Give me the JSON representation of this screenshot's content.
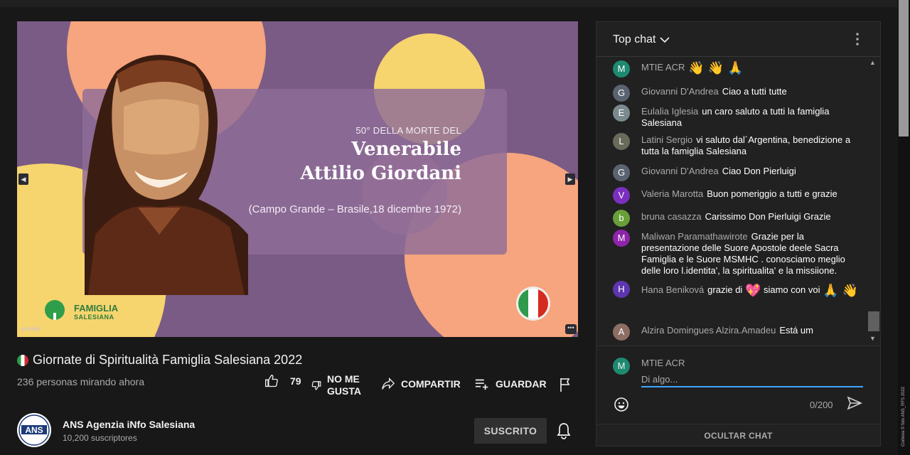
{
  "video": {
    "slide_subtitle": "50° DELLA MORTE DEL",
    "slide_title_line1": "Venerabile",
    "slide_title_line2": "Attilio Giordani",
    "slide_place": "(Campo Grande – Brasile,18 dicembre 1972)",
    "logo_line1": "FAMIGLIA",
    "logo_line2": "SALESIANA",
    "watermark": "genially",
    "colors": {
      "background": "#7a5b85",
      "peach": "#f6a57e",
      "yellow": "#f6d46e",
      "portrait": "#7b3d1f"
    }
  },
  "title": "Giornate di Spiritualità Famiglia Salesiana 2022",
  "viewers": "236 personas mirando ahora",
  "actions": {
    "like_count": "79",
    "dislike_line1": "NO ME",
    "dislike_line2": "GUSTA",
    "share": "COMPARTIR",
    "save": "GUARDAR"
  },
  "channel": {
    "name": "ANS Agenzia iNfo Salesiana",
    "subscribers": "10,200 suscriptores",
    "avatar_text": "ANS",
    "subscribe_state": "SUSCRITO"
  },
  "chat": {
    "mode": "Top chat",
    "messages": [
      {
        "author": "MTIE ACR",
        "text": "",
        "emoji": "👋 👋 🙏",
        "initial": "M",
        "color": "#1e8a70"
      },
      {
        "author": "Giovanni D'Andrea",
        "text": "Ciao a tutti tutte",
        "initial": "G",
        "color": "#5a6470"
      },
      {
        "author": "Eulalia Iglesia",
        "text": "un caro saluto a tutti la famiglia Salesiana",
        "initial": "E",
        "color": "#7b8a8e"
      },
      {
        "author": "Latini Sergio",
        "text": "vi saluto dal´Argentina, benedizione a tutta la famiglia Salesiana",
        "initial": "L",
        "color": "#6a6a5a"
      },
      {
        "author": "Giovanni D'Andrea",
        "text": "Ciao Don Pierluigi",
        "initial": "G",
        "color": "#5a6470"
      },
      {
        "author": "Valeria Marotta",
        "text": "Buon pomeriggio a tutti e grazie",
        "initial": "V",
        "color": "#7b2fbe"
      },
      {
        "author": "bruna casazza",
        "text": "Carissimo Don Pierluigi Grazie",
        "initial": "b",
        "color": "#689f38"
      },
      {
        "author": "Maliwan Paramathawirote",
        "text": "Grazie per la presentazione delle Suore Apostole deele Sacra Famiglia e le Suore MSMHC . conosciamo meglio delle loro l.identita', la spiritualita' e la missiione.",
        "initial": "M",
        "color": "#8e24aa"
      },
      {
        "author": "Hana Beniková",
        "text": "grazie di",
        "emoji": "💖",
        "text2": "siamo con voi",
        "emoji2": "🙏 👋",
        "initial": "H",
        "color": "#5e35b1"
      },
      {
        "author": "Alzira Domingues Alzira.Amadeu",
        "text": "Está um",
        "initial": "A",
        "color": "#8d6e63"
      }
    ],
    "composer": {
      "author": "MTIE ACR",
      "initial": "M",
      "placeholder": "Di algo...",
      "char_count": "0/200"
    },
    "hide_label": "OCULTAR CHAT"
  },
  "credit": "Cortesia © foto ANS_RFS 2022"
}
